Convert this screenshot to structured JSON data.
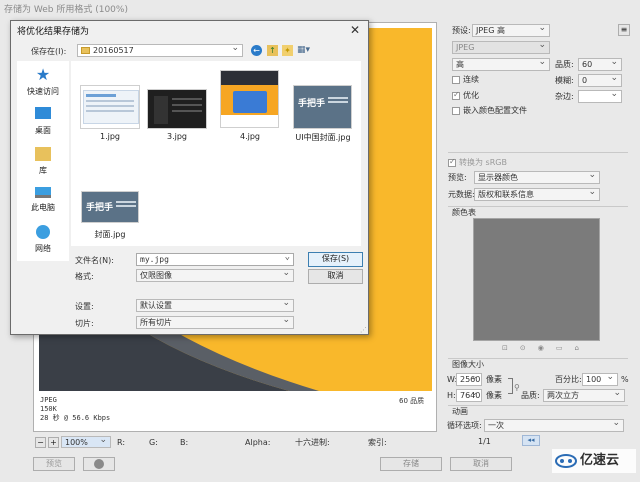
{
  "window_title": "存储为 Web 所用格式 (100%)",
  "dialog": {
    "title": "将优化结果存储为",
    "save_in_label": "保存在(I):",
    "folder": "20160517",
    "nav": [
      "快速访问",
      "桌面",
      "库",
      "此电脑",
      "网络"
    ],
    "files": [
      "1.jpg",
      "3.jpg",
      "4.jpg",
      "UI中国封面.jpg",
      "封面.jpg"
    ],
    "thumb_caption": "手把手",
    "filename_label": "文件名(N):",
    "filename_value": "my.jpg",
    "format_label": "格式:",
    "format_value": "仅限图像",
    "settings_label": "设置:",
    "settings_value": "默认设置",
    "slices_label": "切片:",
    "slices_value": "所有切片",
    "save_button": "保存(S)",
    "cancel_button": "取消",
    "close_icon": "close-icon"
  },
  "right_panel": {
    "preset_label": "预设:",
    "preset_value": "JPEG 高",
    "format_value": "JPEG",
    "quality_level": "高",
    "quality_label": "品质:",
    "quality_value": "60",
    "progressive_label": "连续",
    "blur_label": "模糊:",
    "blur_value": "0",
    "optimized_label": "优化",
    "matte_label": "杂边:",
    "embed_profile_label": "嵌入颜色配置文件",
    "convert_srgb_label": "转换为 sRGB",
    "preview_label": "预览:",
    "preview_value": "显示器颜色",
    "metadata_label": "元数据:",
    "metadata_value": "版权和联系信息",
    "color_table_label": "颜色表",
    "image_size_label": "图像大小",
    "w_label": "W:",
    "w_value": "2560",
    "h_label": "H:",
    "h_value": "7640",
    "unit_px": "像素",
    "percent_label": "百分比:",
    "percent_value": "100",
    "percent_unit": "%",
    "quality2_label": "品质:",
    "resample_value": "两次立方",
    "animation_label": "动画",
    "loop_label": "循环选项:",
    "loop_value": "一次",
    "frame_counter": "1/1"
  },
  "canvas": {
    "info_line1": "JPEG",
    "info_line2": "150K",
    "info_line3": "28 秒 @ 56.6 Kbps",
    "quality_readout": "60 品质",
    "accent_color": "#f9b82b"
  },
  "status_bar": {
    "zoom_value": "100%",
    "r_label": "R:",
    "g_label": "G:",
    "b_label": "B:",
    "alpha_label": "Alpha:",
    "hex_label": "十六进制:",
    "index_label": "索引:"
  },
  "bottom": {
    "preview_button": "预览",
    "save_button": "存储",
    "cancel_button": "取消",
    "watermark": "亿速云"
  }
}
